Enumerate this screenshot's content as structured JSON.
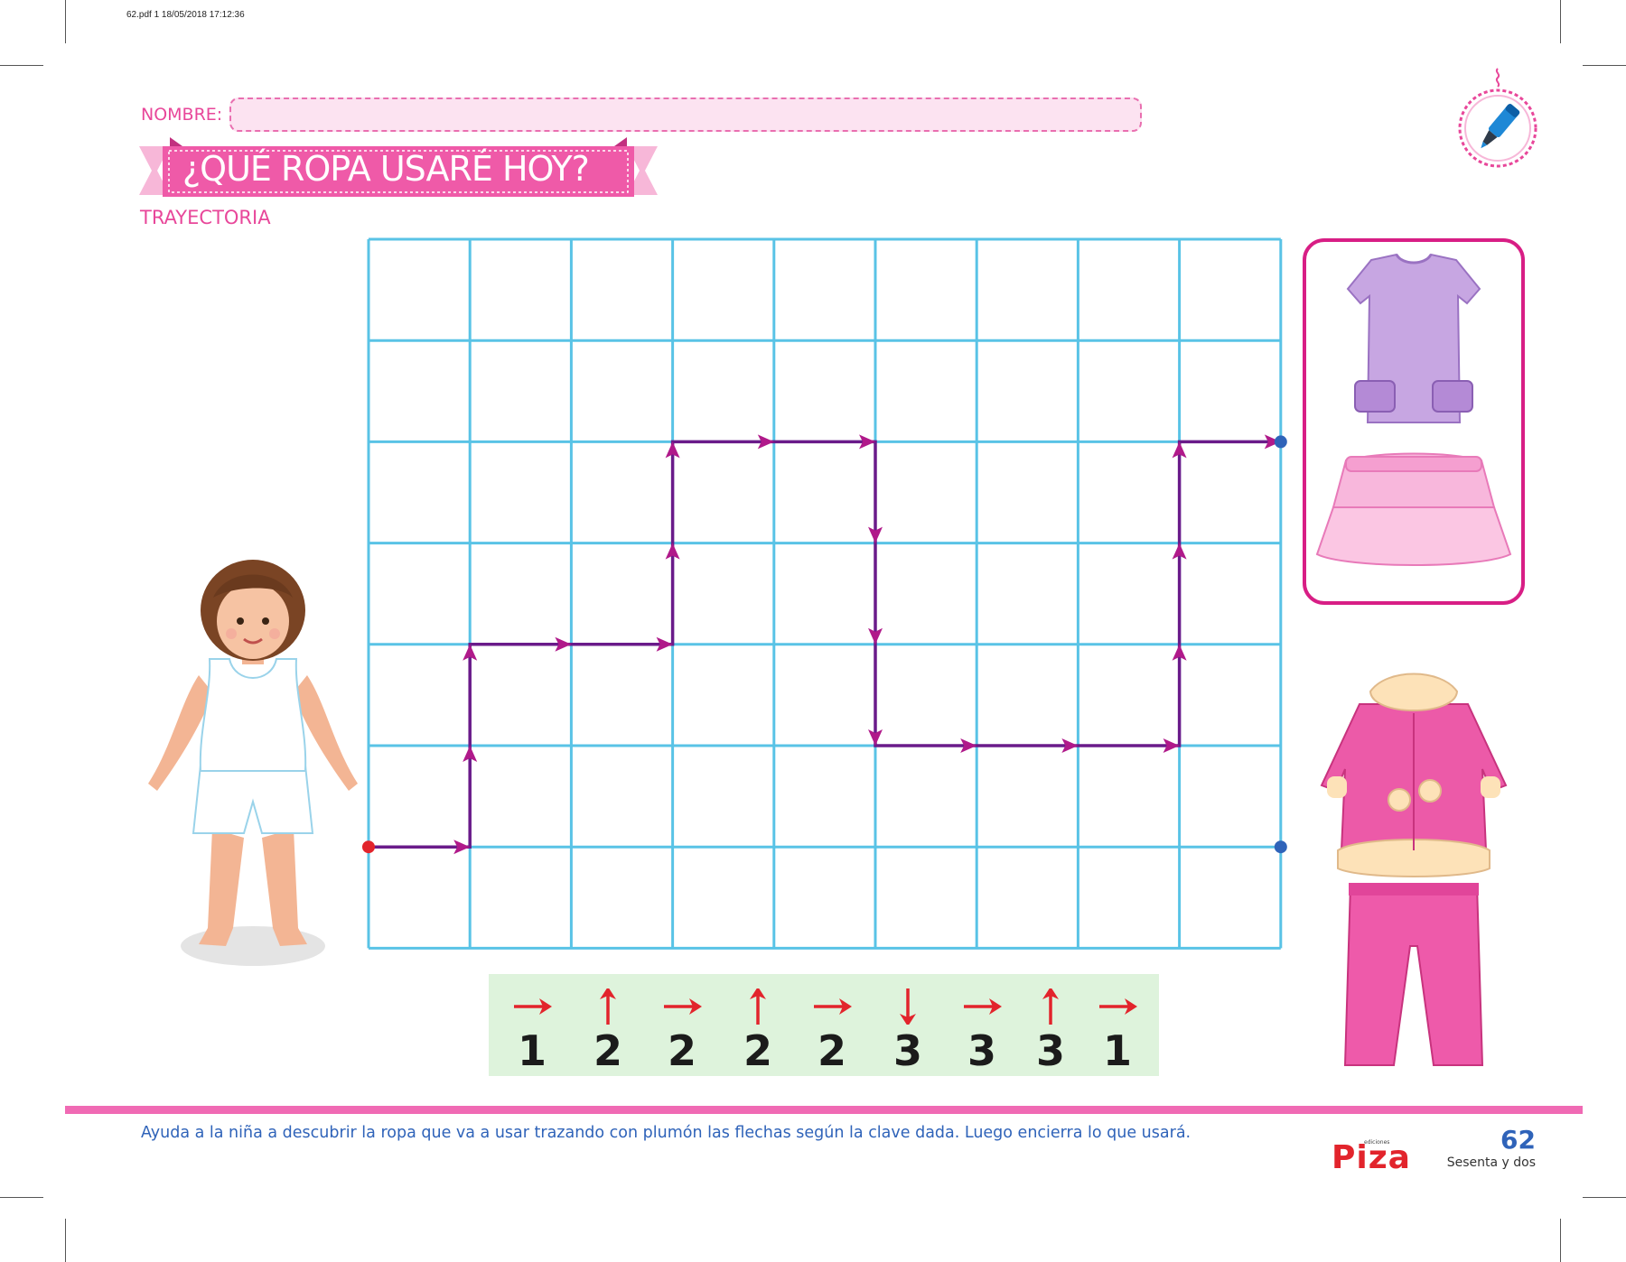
{
  "pdf_header": "62.pdf   1   18/05/2018   17:12:36",
  "name_label": "NOMBRE:",
  "title": "¿QUÉ ROPA USARÉ HOY?",
  "subtitle": "TRAYECTORIA",
  "icons": {
    "badge": "marker-icon",
    "girl": "girl-in-underwear-illustration",
    "outfit_summer": "purple-shirt-and-pink-skirt-illustration",
    "outfit_winter": "pink-coat-and-pink-pants-illustration"
  },
  "grid": {
    "columns": 9,
    "rows": 7,
    "line_color": "#59c3e6",
    "path_color": "#6a1b8a",
    "arrow_color": "#b0198a",
    "start_color": "#e2242c",
    "end_color": "#2f63b9",
    "start": {
      "col": 0,
      "row": 6
    },
    "path_moves": [
      {
        "dir": "right",
        "steps": 1
      },
      {
        "dir": "up",
        "steps": 2
      },
      {
        "dir": "right",
        "steps": 2
      },
      {
        "dir": "up",
        "steps": 2
      },
      {
        "dir": "right",
        "steps": 2
      },
      {
        "dir": "down",
        "steps": 3
      },
      {
        "dir": "right",
        "steps": 3
      },
      {
        "dir": "up",
        "steps": 3
      },
      {
        "dir": "right",
        "steps": 1
      }
    ],
    "endpoints": [
      {
        "col": 9,
        "row": 2
      },
      {
        "col": 9,
        "row": 6
      }
    ]
  },
  "key": {
    "arrow_color": "#e2242c",
    "items": [
      {
        "dir": "right",
        "num": "1"
      },
      {
        "dir": "up",
        "num": "2"
      },
      {
        "dir": "right",
        "num": "2"
      },
      {
        "dir": "up",
        "num": "2"
      },
      {
        "dir": "right",
        "num": "2"
      },
      {
        "dir": "down",
        "num": "3"
      },
      {
        "dir": "right",
        "num": "3"
      },
      {
        "dir": "up",
        "num": "3"
      },
      {
        "dir": "right",
        "num": "1"
      }
    ]
  },
  "footer": {
    "instruction": "Ayuda a la niña a descubrir la ropa que va a usar trazando con plumón las flechas según la clave dada. Luego encierra lo que usará.",
    "brand_small": "ediciones",
    "brand": "Piza",
    "page_number": "62",
    "page_words": "Sesenta y dos"
  },
  "colors": {
    "accent_pink": "#e8479a",
    "banner_pink": "#ef5aa8",
    "footer_blue": "#2f63b9",
    "key_bg": "#def3dc"
  }
}
